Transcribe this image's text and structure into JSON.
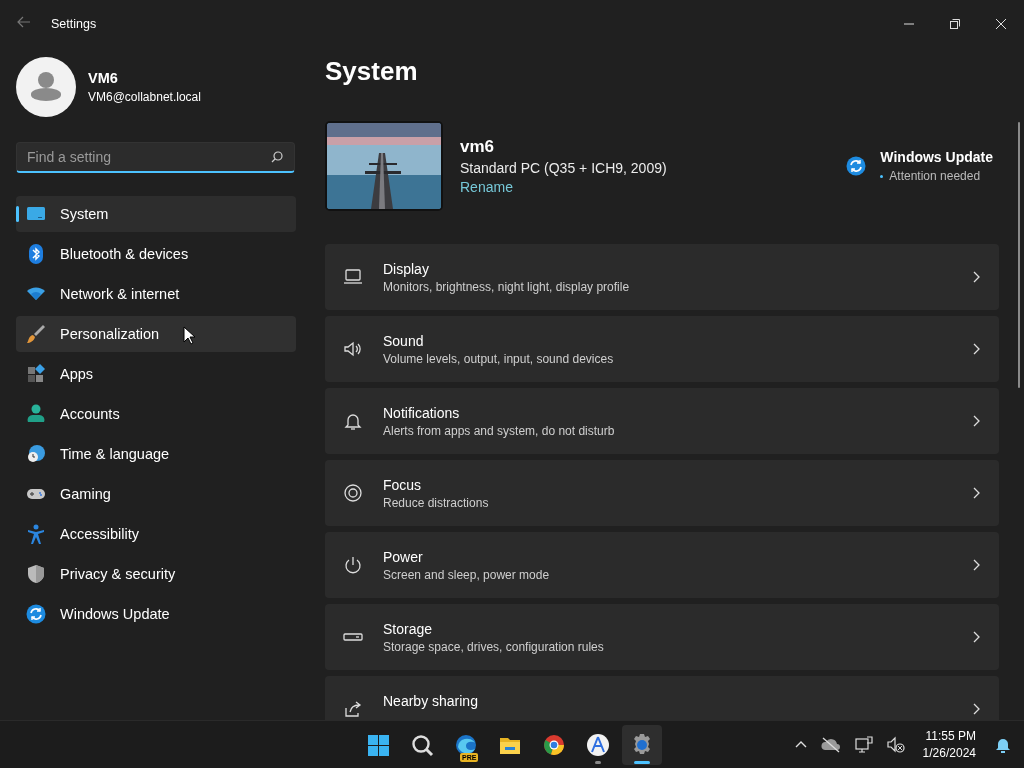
{
  "window": {
    "title": "Settings"
  },
  "user": {
    "name": "VM6",
    "email": "VM6@collabnet.local"
  },
  "search": {
    "placeholder": "Find a setting"
  },
  "nav": [
    {
      "label": "System",
      "selected": true,
      "hovered": false
    },
    {
      "label": "Bluetooth & devices",
      "selected": false,
      "hovered": false
    },
    {
      "label": "Network & internet",
      "selected": false,
      "hovered": false
    },
    {
      "label": "Personalization",
      "selected": false,
      "hovered": true
    },
    {
      "label": "Apps",
      "selected": false,
      "hovered": false
    },
    {
      "label": "Accounts",
      "selected": false,
      "hovered": false
    },
    {
      "label": "Time & language",
      "selected": false,
      "hovered": false
    },
    {
      "label": "Gaming",
      "selected": false,
      "hovered": false
    },
    {
      "label": "Accessibility",
      "selected": false,
      "hovered": false
    },
    {
      "label": "Privacy & security",
      "selected": false,
      "hovered": false
    },
    {
      "label": "Windows Update",
      "selected": false,
      "hovered": false
    }
  ],
  "page_title": "System",
  "device": {
    "name": "vm6",
    "model": "Standard PC (Q35 + ICH9, 2009)",
    "rename": "Rename"
  },
  "update": {
    "title": "Windows Update",
    "status": "Attention needed"
  },
  "cards": [
    {
      "title": "Display",
      "subtitle": "Monitors, brightness, night light, display profile"
    },
    {
      "title": "Sound",
      "subtitle": "Volume levels, output, input, sound devices"
    },
    {
      "title": "Notifications",
      "subtitle": "Alerts from apps and system, do not disturb"
    },
    {
      "title": "Focus",
      "subtitle": "Reduce distractions"
    },
    {
      "title": "Power",
      "subtitle": "Screen and sleep, power mode"
    },
    {
      "title": "Storage",
      "subtitle": "Storage space, drives, configuration rules"
    },
    {
      "title": "Nearby sharing"
    }
  ],
  "taskbar": {
    "apps": [
      {
        "selected": false,
        "running": false
      },
      {
        "selected": false,
        "running": false
      },
      {
        "selected": false,
        "running": false,
        "badge": "PRE"
      },
      {
        "selected": false,
        "running": false
      },
      {
        "selected": false,
        "running": false
      },
      {
        "selected": false,
        "running": true
      },
      {
        "selected": true,
        "running": true
      }
    ],
    "time": "11:55 PM",
    "date": "1/26/2024"
  }
}
